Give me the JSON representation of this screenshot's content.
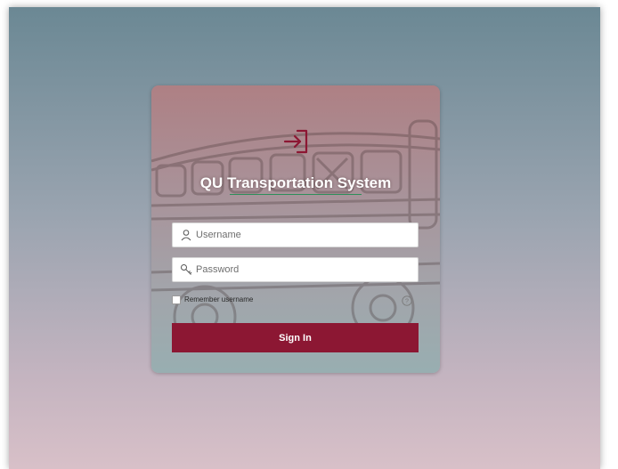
{
  "login": {
    "title": "QU Transportation System",
    "username": {
      "placeholder": "Username",
      "value": ""
    },
    "password": {
      "placeholder": "Password",
      "value": ""
    },
    "remember_label": "Remember username",
    "remember_checked": false,
    "sign_in_label": "Sign In"
  },
  "icons": {
    "sign_in": "sign-in-arrow-icon",
    "user": "user-icon",
    "key": "key-icon",
    "help": "help-circle-icon"
  },
  "colors": {
    "accent": "#8c1733",
    "title_underline": "#2e8f5a",
    "background_top": "#6b8894",
    "background_bottom": "#d8c0c8"
  }
}
